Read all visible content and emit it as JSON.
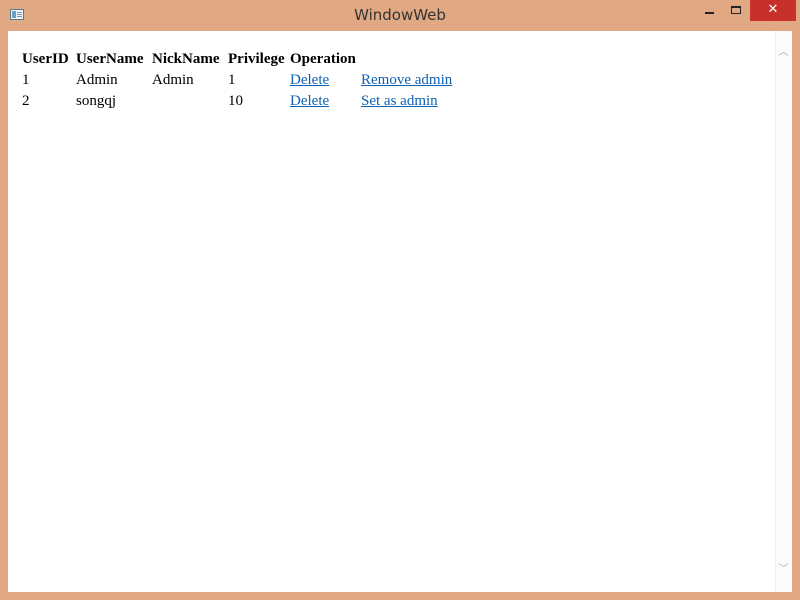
{
  "window": {
    "title": "WindowWeb",
    "close_glyph": "✕"
  },
  "table": {
    "headers": [
      "UserID",
      "UserName",
      "NickName",
      "Privilege",
      "Operation"
    ],
    "rows": [
      {
        "id": "1",
        "username": "Admin",
        "nickname": "Admin",
        "privilege": "1",
        "delete_label": "Delete",
        "admin_action_label": "Remove admin"
      },
      {
        "id": "2",
        "username": "songqj",
        "nickname": "",
        "privilege": "10",
        "delete_label": "Delete",
        "admin_action_label": "Set as admin"
      }
    ]
  },
  "colors": {
    "frame": "#e0a983",
    "link": "#0f62b3",
    "close_button": "#c7302b"
  },
  "icons": {
    "app": "app-window-icon",
    "minimize": "minimize-icon",
    "maximize": "maximize-icon",
    "close": "close-icon",
    "scroll_up": "chevron-up-icon",
    "scroll_down": "chevron-down-icon"
  }
}
